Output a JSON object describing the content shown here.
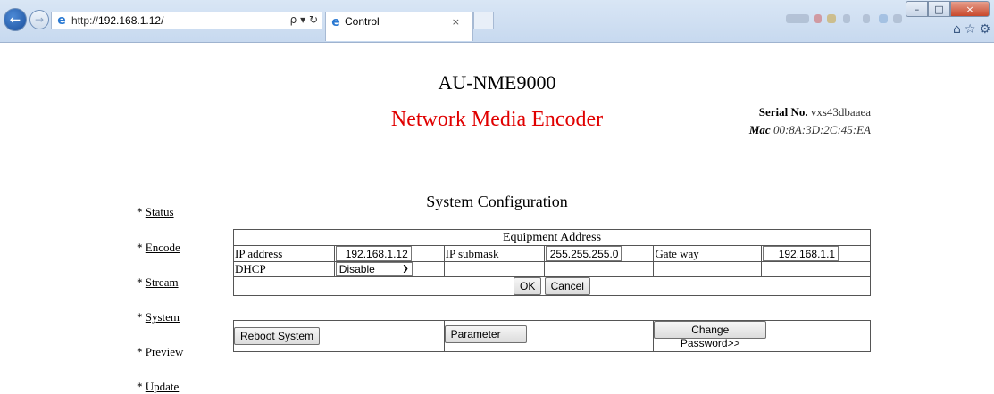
{
  "browser": {
    "url_protocol": "http://",
    "url_host": "192.168.1.12/",
    "addr_tools": "ρ ▾ ↻",
    "tab_title": "Control",
    "tab_close": "×",
    "window_min": "–",
    "window_max": "□",
    "window_close": "×"
  },
  "header": {
    "model": "AU-NME9000",
    "subtitle": "Network Media Encoder",
    "serial_label": "Serial No.",
    "serial_value": "vxs43dbaaea",
    "mac_label": "Mac",
    "mac_value": "00:8A:3D:2C:45:EA"
  },
  "menu": {
    "bullet": "* ",
    "items": [
      "Status",
      "Encode",
      "Stream",
      "System",
      "Preview",
      "Update"
    ]
  },
  "main": {
    "title": "System Configuration",
    "equipment": {
      "header": "Equipment Address",
      "ip_label": "IP address",
      "ip_value": "192.168.1.12",
      "submask_label": "IP submask",
      "submask_value": "255.255.255.0",
      "gateway_label": "Gate way",
      "gateway_value": "192.168.1.1",
      "dhcp_label": "DHCP",
      "dhcp_value": "Disable",
      "ok_label": "OK",
      "cancel_label": "Cancel"
    },
    "actions": {
      "reboot_label": "Reboot System",
      "reset_label": "Parameter Rese",
      "password_label": "Change Password>>"
    }
  },
  "colors": {
    "accent_red": "#e00000"
  }
}
